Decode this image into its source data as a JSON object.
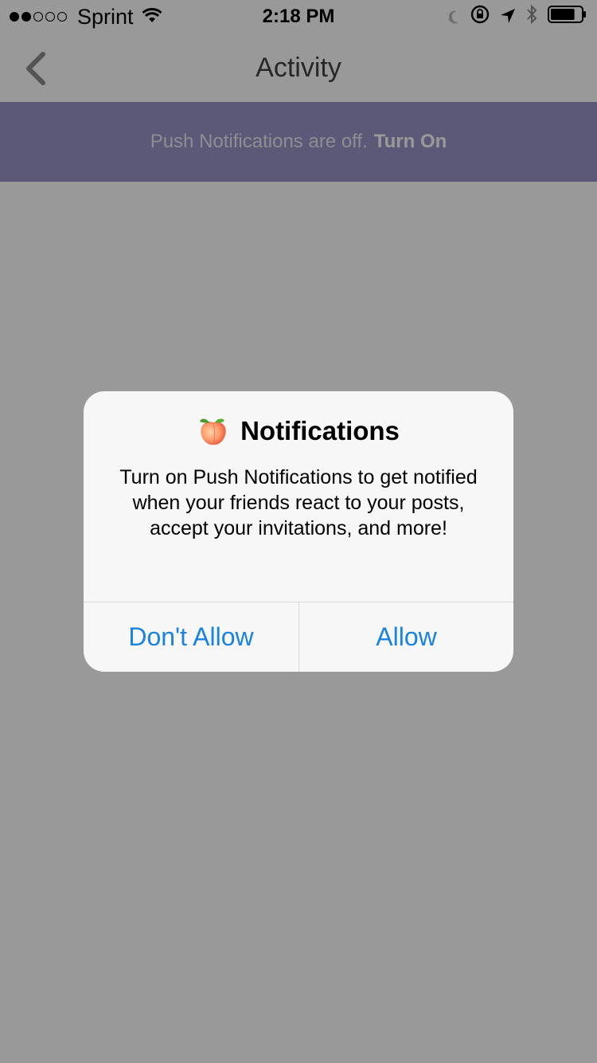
{
  "status_bar": {
    "signal_filled": 2,
    "signal_total": 5,
    "carrier": "Sprint",
    "time": "2:18 PM",
    "icons": [
      "wifi-icon",
      "do-not-disturb-icon",
      "orientation-lock-icon",
      "location-arrow-icon",
      "bluetooth-icon",
      "battery-icon"
    ],
    "battery_level": 0.8
  },
  "nav": {
    "back_icon": "chevron-left-icon",
    "title": "Activity"
  },
  "banner": {
    "text": "Push Notifications are off.",
    "action": "Turn On"
  },
  "alert": {
    "icon": "peach-emoji-icon",
    "title": "Notifications",
    "message": "Turn on Push Notifications to get notified when your friends react to your posts, accept your invitations, and more!",
    "buttons": {
      "dont_allow": "Don't Allow",
      "allow": "Allow"
    }
  },
  "colors": {
    "banner_bg": "#9a93c6",
    "button_text": "#1a82e0",
    "overlay": "rgba(0,0,0,0.40)"
  }
}
